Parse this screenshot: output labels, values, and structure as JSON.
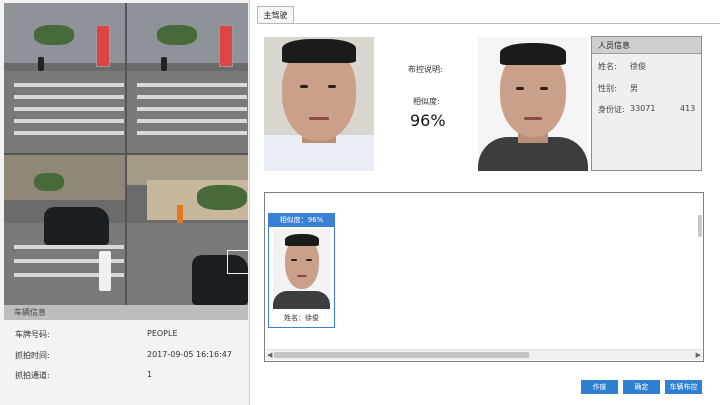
{
  "vehicle_info": {
    "title": "车辆信息",
    "rows": [
      {
        "label": "车牌号码:",
        "value": "PEOPLE"
      },
      {
        "label": "抓拍时间:",
        "value": "2017-09-05 16:16:47"
      },
      {
        "label": "抓拍通道:",
        "value": "1"
      }
    ]
  },
  "tab": {
    "label": "主驾驶"
  },
  "match": {
    "control_desc_label": "布控说明:",
    "similarity_label": "相似度:",
    "similarity_value": "96%"
  },
  "person_info": {
    "title": "人员信息",
    "name_label": "姓名:",
    "name_value": "徐俊",
    "gender_label": "性别:",
    "gender_value": "男",
    "id_label": "身份证:",
    "id_value_start": "33071",
    "id_value_end": "413"
  },
  "result_card": {
    "header": "相似度：96%",
    "name": "姓名：徐俊"
  },
  "buttons": {
    "cancel": "作废",
    "confirm": "确定",
    "vehicle_control": "车辆布控"
  },
  "colors": {
    "accent": "#2f7fd3",
    "card_border": "#3a80d4"
  }
}
